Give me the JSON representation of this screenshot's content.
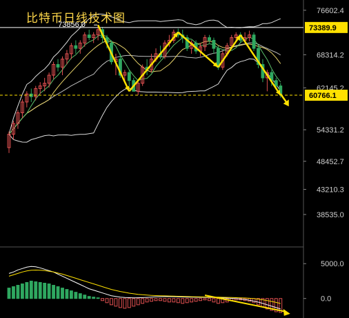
{
  "title": "比特币日线技术图",
  "price_axis": {
    "min": 33000,
    "max": 78000,
    "ticks": [
      76602.4,
      68314.2,
      62145.2,
      54331.2,
      48452.7,
      43210.3,
      38535.0
    ]
  },
  "resistance": {
    "value": 73389.9,
    "label": "73389.9",
    "color": "#ffffff",
    "tag_bg": "#ffe100"
  },
  "support": {
    "value": 60766.1,
    "label": "60766.1",
    "color": "#ffe100",
    "tag_bg": "#ffe100"
  },
  "high_annotation": {
    "value": 73856.0,
    "label": "73856.0"
  },
  "macd_axis": {
    "min": -2500,
    "max": 7000,
    "ticks": [
      5000.0,
      0.0
    ]
  },
  "colors": {
    "up": "#e05050",
    "down": "#2fa860",
    "arrow": "#ffe100",
    "macd_pos": "#2fa860",
    "macd_neg": "#e05050"
  },
  "chart_data": {
    "type": "candlestick",
    "title": "比特币日线技术图",
    "series": {
      "open": [
        51000,
        53500,
        55500,
        57500,
        59500,
        61000,
        60500,
        62000,
        62500,
        63000,
        64500,
        66500,
        66000,
        67500,
        68500,
        70000,
        69500,
        70500,
        72000,
        71500,
        72000,
        73000,
        71500,
        70500,
        67000,
        67500,
        64500,
        65000,
        63500,
        61500,
        63000,
        66000,
        65500,
        67500,
        68500,
        68000,
        70500,
        71000,
        72500,
        72000,
        71500,
        69500,
        70500,
        69000,
        69800,
        71500,
        71000,
        69500,
        66000,
        68500,
        70000,
        71500,
        72000,
        71000,
        71500,
        72000,
        69500,
        66500,
        64000,
        65000,
        63500,
        62500
      ],
      "high": [
        54000,
        56000,
        58000,
        60000,
        61500,
        62000,
        62500,
        63200,
        64000,
        65000,
        67000,
        67500,
        68000,
        69200,
        70500,
        71000,
        71000,
        72500,
        73000,
        72500,
        73856,
        73500,
        72000,
        71000,
        68500,
        68500,
        65500,
        65500,
        64000,
        63500,
        66500,
        67500,
        68500,
        69500,
        70000,
        71000,
        72000,
        73000,
        73200,
        73000,
        72000,
        71000,
        71000,
        70500,
        72000,
        72000,
        71500,
        70000,
        69000,
        70500,
        72000,
        72500,
        72500,
        72500,
        72800,
        72500,
        70000,
        67500,
        65500,
        65500,
        64000,
        63000
      ],
      "low": [
        50000,
        52500,
        54500,
        56500,
        58500,
        59500,
        59800,
        61000,
        61500,
        62200,
        63800,
        65200,
        64500,
        66500,
        67500,
        68500,
        68500,
        69800,
        71000,
        70500,
        71000,
        70500,
        69500,
        66500,
        64500,
        64000,
        63000,
        62500,
        61500,
        60800,
        62500,
        64500,
        65000,
        67000,
        67500,
        67500,
        69800,
        70500,
        71500,
        70500,
        69000,
        68500,
        68500,
        68000,
        69000,
        70500,
        68500,
        65500,
        65500,
        68000,
        69500,
        70800,
        70500,
        70500,
        70800,
        69000,
        65800,
        63200,
        61500,
        62500,
        61800,
        60300
      ],
      "close": [
        53500,
        55500,
        57500,
        59500,
        61000,
        60500,
        62000,
        62500,
        63000,
        64500,
        66500,
        66000,
        67500,
        68500,
        70000,
        69500,
        70500,
        72000,
        71500,
        72000,
        73000,
        71500,
        70500,
        67000,
        67500,
        64500,
        65000,
        63500,
        61500,
        63000,
        66000,
        65500,
        67500,
        68500,
        68000,
        70500,
        71000,
        72500,
        72000,
        71500,
        69500,
        70500,
        69000,
        69800,
        71500,
        71000,
        69500,
        66000,
        68500,
        70000,
        71500,
        72000,
        71000,
        71500,
        72000,
        69500,
        66500,
        64000,
        65000,
        63500,
        62500,
        61000
      ]
    },
    "macd": {
      "histogram": [
        1500,
        1700,
        1900,
        2100,
        2300,
        2500,
        2400,
        2300,
        2200,
        2100,
        1900,
        1700,
        1500,
        1300,
        1100,
        900,
        700,
        500,
        300,
        200,
        100,
        -300,
        -600,
        -900,
        -1100,
        -1300,
        -1400,
        -1300,
        -1100,
        -900,
        -700,
        -500,
        -400,
        -300,
        -300,
        -400,
        -500,
        -500,
        -600,
        -700,
        -600,
        -500,
        -400,
        -300,
        -200,
        -300,
        -500,
        -700,
        -600,
        -500,
        -300,
        -200,
        -200,
        -300,
        -400,
        -600,
        -900,
        -1200,
        -1500,
        -1700,
        -1900,
        -2000
      ],
      "dif": [
        3600,
        3800,
        4100,
        4300,
        4500,
        4600,
        4550,
        4400,
        4200,
        4000,
        3800,
        3500,
        3200,
        2900,
        2600,
        2300,
        2000,
        1700,
        1400,
        1200,
        1000,
        800,
        600,
        400,
        300,
        200,
        150,
        120,
        100,
        110,
        130,
        160,
        200,
        240,
        260,
        270,
        270,
        260,
        240,
        220,
        200,
        190,
        180,
        170,
        170,
        160,
        150,
        130,
        100,
        60,
        20,
        -20,
        -80,
        -150,
        -250,
        -380,
        -520,
        -700,
        -900,
        -1100,
        -1300,
        -1500
      ],
      "dea": [
        3200,
        3400,
        3600,
        3800,
        3950,
        4050,
        4080,
        4050,
        4000,
        3900,
        3800,
        3650,
        3500,
        3300,
        3100,
        2900,
        2700,
        2500,
        2300,
        2100,
        1900,
        1700,
        1500,
        1300,
        1150,
        1000,
        880,
        770,
        680,
        600,
        540,
        490,
        450,
        420,
        400,
        380,
        360,
        340,
        320,
        300,
        280,
        260,
        245,
        230,
        220,
        210,
        200,
        190,
        175,
        160,
        145,
        125,
        100,
        70,
        30,
        -20,
        -90,
        -180,
        -290,
        -420,
        -560,
        -720
      ]
    },
    "ylim": [
      33000,
      78000
    ]
  }
}
